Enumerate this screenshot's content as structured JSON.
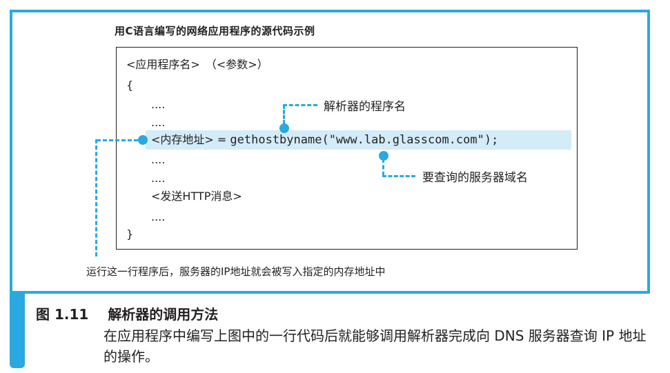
{
  "figure": {
    "title": "用C语言编写的网络应用程序的源代码示例",
    "code": {
      "line1": "<应用程序名>　（<参数>）",
      "line2": "{",
      "line3": "....",
      "line4": "....",
      "line5_prefix": "<内存地址> = ",
      "line5_code": "gethostbyname(\"www.lab.glasscom.com\");",
      "line6": "....",
      "line7": "....",
      "line8": "<发送HTTP消息>",
      "line9": "....",
      "line10": "}"
    },
    "annotations": {
      "resolver_name": "解析器的程序名",
      "server_domain": "要查询的服务器域名"
    },
    "note": "运行这一行程序后，服务器的IP地址就会被写入指定的内存地址中"
  },
  "caption": {
    "number": "图 1.11",
    "title": "解析器的调用方法",
    "description": "在应用程序中编写上图中的一行代码后就能够调用解析器完成向 DNS 服务器查询 IP 地址的操作。"
  },
  "colors": {
    "accent": "#29a9df",
    "highlight": "#d4ecf7",
    "text": "#231f20"
  }
}
